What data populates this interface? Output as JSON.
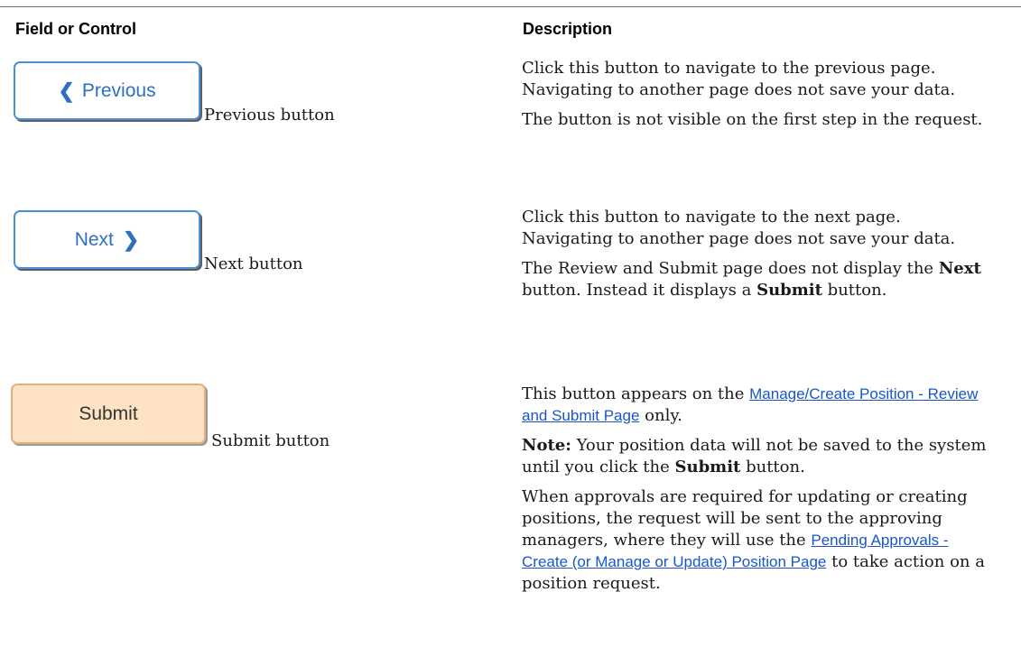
{
  "table": {
    "headers": {
      "field": "Field or Control",
      "description": "Description"
    },
    "rows": [
      {
        "button_text": "Previous",
        "button_icon": "chevron-left-icon",
        "label": "Previous button",
        "paragraphs": [
          "Click this button to navigate to the previous page. Navigating to another page does not save your data.",
          "The button is not visible on the first step in the request."
        ]
      },
      {
        "button_text": "Next",
        "button_icon": "chevron-right-icon",
        "label": "Next button",
        "paragraphs": [
          "Click this button to navigate to the next page. Navigating to another page does not save your data."
        ],
        "review_note": {
          "t1": "The Review and Submit page does not display the ",
          "b1": "Next",
          "t2": " button. Instead it displays a ",
          "b2": "Submit",
          "t3": " button."
        }
      },
      {
        "button_text": "Submit",
        "label": "Submit button",
        "appears": {
          "t1": "This button appears on the ",
          "link": "Manage/Create Position - Review and Submit Page",
          "t2": " only."
        },
        "note": {
          "b1": "Note:",
          "t1": " Your position data will not be saved to the system until you click the ",
          "b2": "Submit",
          "t2": " button."
        },
        "approvals": {
          "t1": "When approvals are required for updating or creating positions, the request will be sent to the approving managers, where they will use the ",
          "link": "Pending Approvals - Create (or Manage or Update) Position Page",
          "t2": " to take action on a position request."
        }
      }
    ]
  },
  "colors": {
    "link": "#1a56c8",
    "blue_button_border": "#4a90d9",
    "blue_button_text": "#2f6fbf",
    "submit_bg": "#fde3c4",
    "submit_border": "#e0b27a"
  }
}
